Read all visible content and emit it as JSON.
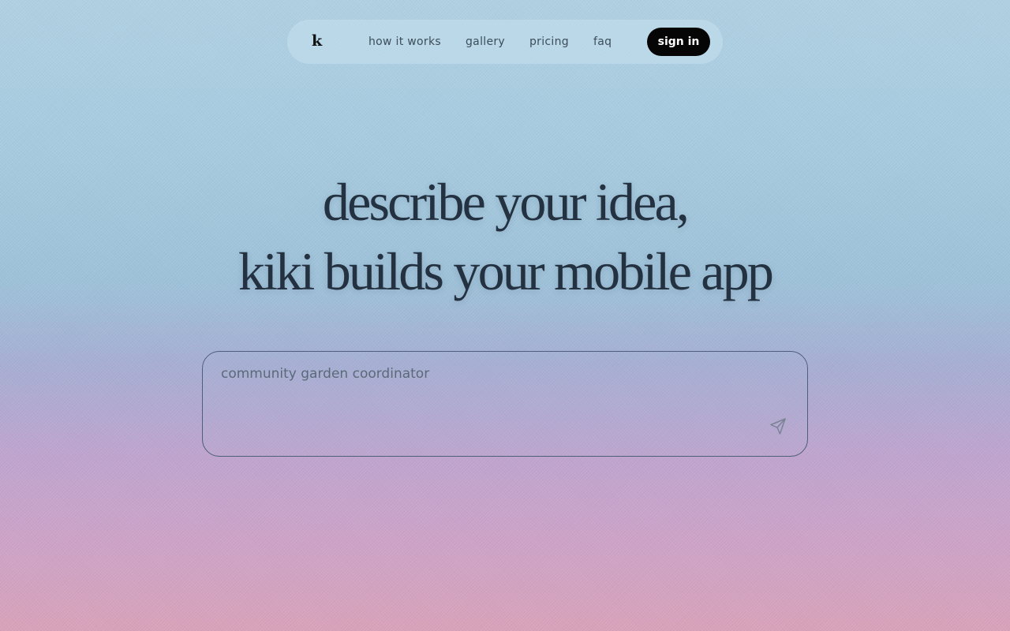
{
  "nav": {
    "logo": "k",
    "links": [
      "how it works",
      "gallery",
      "pricing",
      "faq"
    ],
    "signin_label": "sign in"
  },
  "hero": {
    "line1": "describe your idea,",
    "line2": "kiki builds your mobile app"
  },
  "prompt": {
    "value": "community garden coordinator",
    "send_icon": "send-icon"
  }
}
